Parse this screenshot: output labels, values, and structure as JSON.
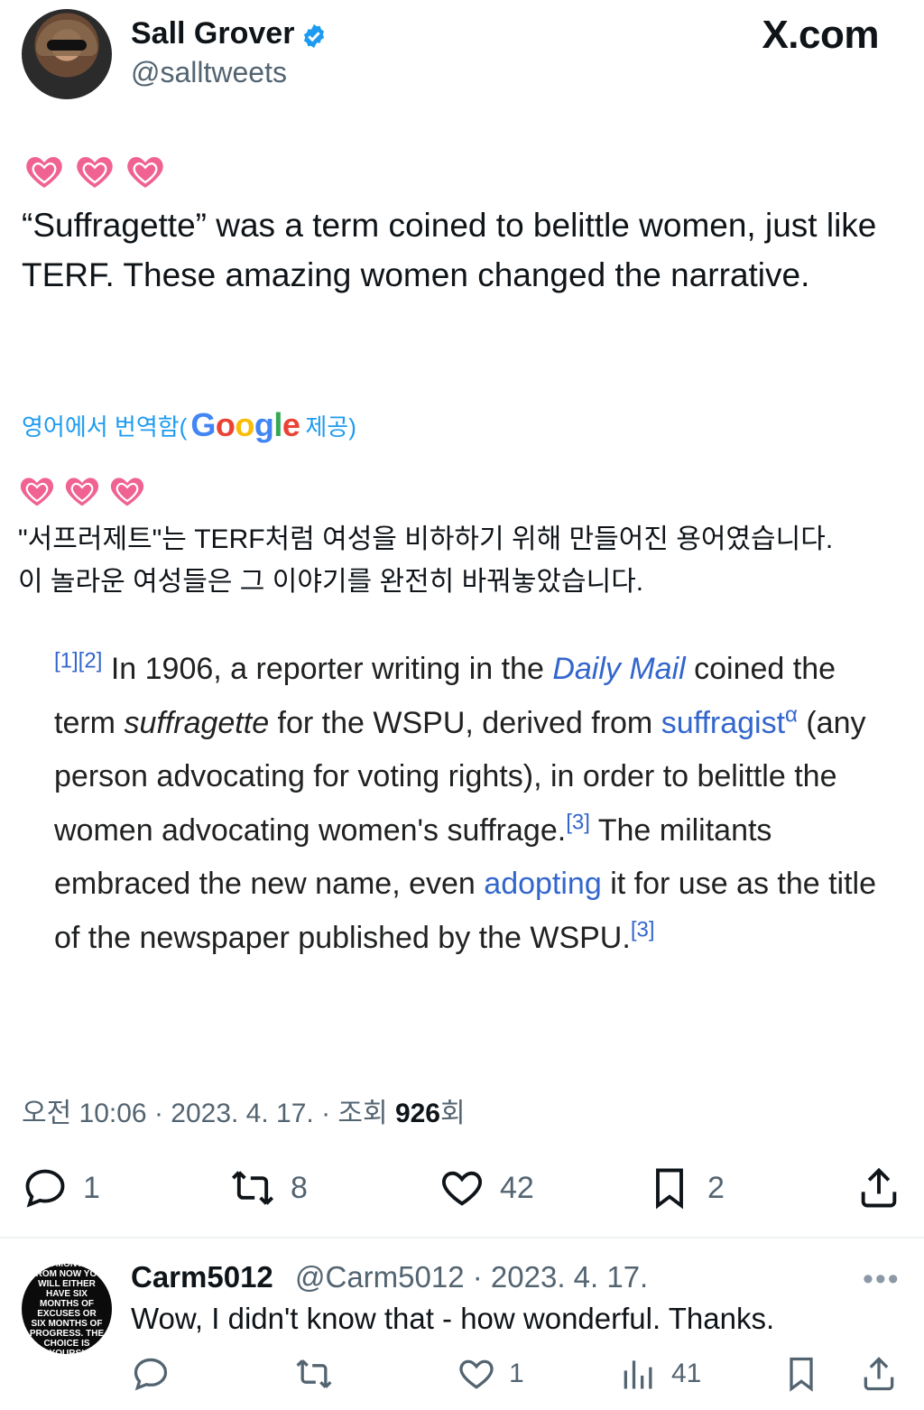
{
  "header": {
    "display_name": "Sall Grover",
    "handle": "@salltweets",
    "verified_icon": "verified-badge-icon",
    "site": "X.com"
  },
  "tweet": {
    "emojis": "💗💗💗",
    "text": "“Suffragette” was a term coined to belittle women, just like TERF. These amazing women changed the narrative.",
    "translation_prefix": "영어에서 번역함(",
    "translation_provider": "Google",
    "translation_suffix": "제공)",
    "translated_text_line1": "\"서프러제트\"는 TERF처럼 여성을 비하하기 위해 만들어진 용어였습니다.",
    "translated_text_line2": "이 놀라운 여성들은 그 이야기를 완전히 바꿔놓았습니다."
  },
  "wiki_excerpt": {
    "ref1": "[1][2]",
    "p1": " In 1906, a reporter writing in the ",
    "link_daily_mail": "Daily Mail",
    "p2": " coined the term ",
    "term_suffragette": "suffragette",
    "p3": " for the WSPU, derived from ",
    "link_suffragist": "suffragist",
    "ref_alpha": "α",
    "p4": " (any person advocating for voting rights), in order to belittle the women advocating women's suffrage.",
    "ref3a": "[3]",
    "p5": " The militants embraced the new name, even ",
    "link_adopting": "adopting",
    "p6": " it for use as the title of the newspaper published by the WSPU.",
    "ref3b": "[3]"
  },
  "meta": {
    "time_date": "오전 10:06 · 2023. 4. 17. · 조회 ",
    "views": "926",
    "views_suffix": "회"
  },
  "actions": {
    "replies": "1",
    "reposts": "8",
    "likes": "42",
    "bookmarks": "2"
  },
  "reply": {
    "avatar_text": "Six months from now you will either have six months of excuses or six months of progress. The choice is yours!",
    "name": "Carm5012",
    "handle_date": "@Carm5012 · 2023. 4. 17.",
    "more": "•••",
    "text": "Wow, I didn't know that - how wonderful. Thanks.",
    "likes": "1",
    "views": "41"
  },
  "colors": {
    "link_blue": "#1d9bf0",
    "wiki_link": "#3366cc",
    "muted": "#536471",
    "heart_pink": "#f06292"
  }
}
